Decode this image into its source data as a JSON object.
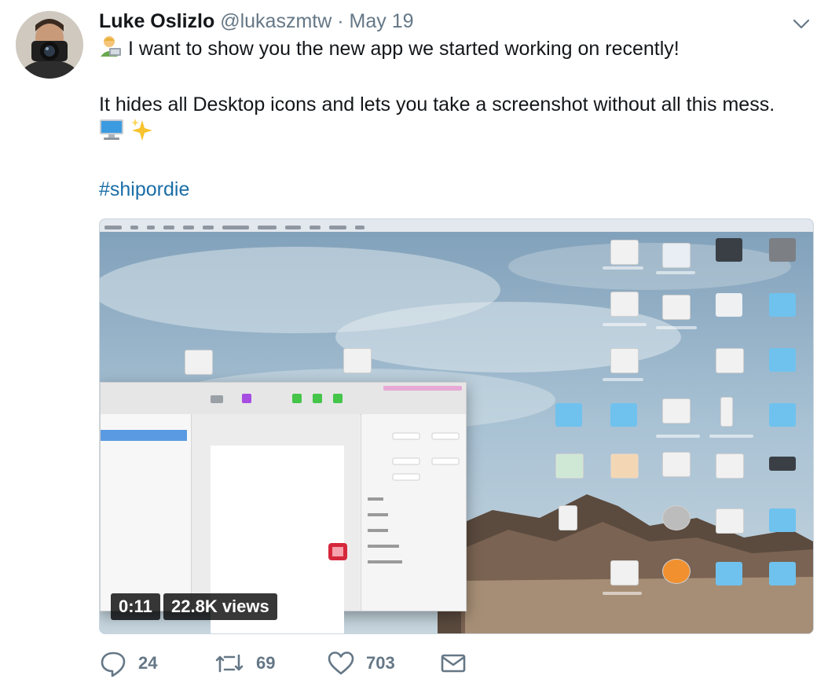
{
  "tweet": {
    "author_name": "Luke Oslizlo",
    "author_handle": "@lukaszmtw",
    "separator": "·",
    "date": "May 19",
    "text_line1": "I want to show you the new app we started working on recently!",
    "text_line2": "It hides all Desktop icons and lets you take a screenshot without all this mess.",
    "hashtag": "#shipordie",
    "emoji_line1": "developer-emoji",
    "emoji_line3": [
      "desktop-computer-emoji",
      "sparkles-emoji"
    ]
  },
  "video": {
    "duration": "0:11",
    "views": "22.8K views"
  },
  "actions": {
    "reply_count": "24",
    "retweet_count": "69",
    "like_count": "703"
  },
  "colors": {
    "text": "#14171a",
    "muted": "#657786",
    "hashtag": "#1b6ea8"
  }
}
